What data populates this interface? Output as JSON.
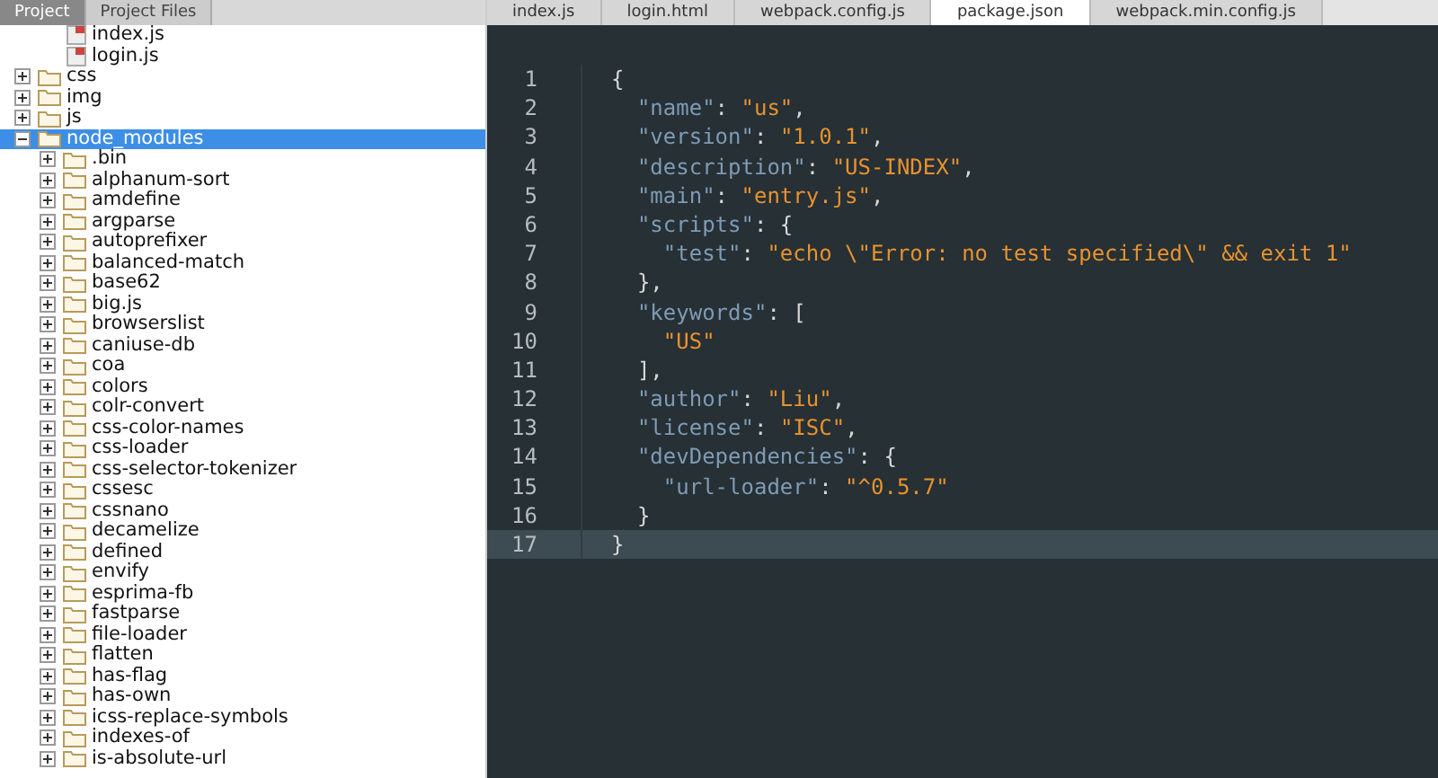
{
  "sidebar": {
    "tabs": [
      {
        "label": "Project",
        "selected": true
      },
      {
        "label": "Project Files",
        "selected": false
      }
    ],
    "tree": [
      {
        "label": "index.js",
        "kind": "file",
        "selected": false
      },
      {
        "label": "login.js",
        "kind": "file",
        "selected": false
      },
      {
        "label": "css",
        "kind": "folder",
        "expanded": false,
        "selected": false
      },
      {
        "label": "img",
        "kind": "folder",
        "expanded": false,
        "selected": false
      },
      {
        "label": "js",
        "kind": "folder",
        "expanded": false,
        "selected": false
      },
      {
        "label": "node_modules",
        "kind": "folder",
        "expanded": true,
        "selected": true,
        "children": [
          {
            "label": ".bin",
            "kind": "folder",
            "expanded": false,
            "selected": false
          },
          {
            "label": "alphanum-sort",
            "kind": "folder",
            "expanded": false,
            "selected": false
          },
          {
            "label": "amdefine",
            "kind": "folder",
            "expanded": false,
            "selected": false
          },
          {
            "label": "argparse",
            "kind": "folder",
            "expanded": false,
            "selected": false
          },
          {
            "label": "autoprefixer",
            "kind": "folder",
            "expanded": false,
            "selected": false
          },
          {
            "label": "balanced-match",
            "kind": "folder",
            "expanded": false,
            "selected": false
          },
          {
            "label": "base62",
            "kind": "folder",
            "expanded": false,
            "selected": false
          },
          {
            "label": "big.js",
            "kind": "folder",
            "expanded": false,
            "selected": false
          },
          {
            "label": "browserslist",
            "kind": "folder",
            "expanded": false,
            "selected": false
          },
          {
            "label": "caniuse-db",
            "kind": "folder",
            "expanded": false,
            "selected": false
          },
          {
            "label": "coa",
            "kind": "folder",
            "expanded": false,
            "selected": false
          },
          {
            "label": "colors",
            "kind": "folder",
            "expanded": false,
            "selected": false
          },
          {
            "label": "colr-convert",
            "kind": "folder",
            "expanded": false,
            "selected": false
          },
          {
            "label": "css-color-names",
            "kind": "folder",
            "expanded": false,
            "selected": false
          },
          {
            "label": "css-loader",
            "kind": "folder",
            "expanded": false,
            "selected": false
          },
          {
            "label": "css-selector-tokenizer",
            "kind": "folder",
            "expanded": false,
            "selected": false
          },
          {
            "label": "cssesc",
            "kind": "folder",
            "expanded": false,
            "selected": false
          },
          {
            "label": "cssnano",
            "kind": "folder",
            "expanded": false,
            "selected": false
          },
          {
            "label": "decamelize",
            "kind": "folder",
            "expanded": false,
            "selected": false
          },
          {
            "label": "defined",
            "kind": "folder",
            "expanded": false,
            "selected": false
          },
          {
            "label": "envify",
            "kind": "folder",
            "expanded": false,
            "selected": false
          },
          {
            "label": "esprima-fb",
            "kind": "folder",
            "expanded": false,
            "selected": false
          },
          {
            "label": "fastparse",
            "kind": "folder",
            "expanded": false,
            "selected": false
          },
          {
            "label": "file-loader",
            "kind": "folder",
            "expanded": false,
            "selected": false
          },
          {
            "label": "flatten",
            "kind": "folder",
            "expanded": false,
            "selected": false
          },
          {
            "label": "has-flag",
            "kind": "folder",
            "expanded": false,
            "selected": false
          },
          {
            "label": "has-own",
            "kind": "folder",
            "expanded": false,
            "selected": false
          },
          {
            "label": "icss-replace-symbols",
            "kind": "folder",
            "expanded": false,
            "selected": false
          },
          {
            "label": "indexes-of",
            "kind": "folder",
            "expanded": false,
            "selected": false
          },
          {
            "label": "is-absolute-url",
            "kind": "folder",
            "expanded": false,
            "selected": false
          }
        ]
      }
    ]
  },
  "editor": {
    "tabs": [
      {
        "label": "index.js",
        "selected": false
      },
      {
        "label": "login.html",
        "selected": false
      },
      {
        "label": "webpack.config.js",
        "selected": false
      },
      {
        "label": "package.json",
        "selected": true
      },
      {
        "label": "webpack.min.config.js",
        "selected": false
      }
    ],
    "lines": [
      {
        "number": "1",
        "current": false,
        "tokens": [
          {
            "kind": "punct",
            "text": "{"
          }
        ]
      },
      {
        "number": "2",
        "current": false,
        "tokens": [
          {
            "kind": "key",
            "text": "  \"name\""
          },
          {
            "kind": "punct",
            "text": ": "
          },
          {
            "kind": "string",
            "text": "\"us\""
          },
          {
            "kind": "punct",
            "text": ","
          }
        ]
      },
      {
        "number": "3",
        "current": false,
        "tokens": [
          {
            "kind": "key",
            "text": "  \"version\""
          },
          {
            "kind": "punct",
            "text": ": "
          },
          {
            "kind": "string",
            "text": "\"1.0.1\""
          },
          {
            "kind": "punct",
            "text": ","
          }
        ]
      },
      {
        "number": "4",
        "current": false,
        "tokens": [
          {
            "kind": "key",
            "text": "  \"description\""
          },
          {
            "kind": "punct",
            "text": ": "
          },
          {
            "kind": "string",
            "text": "\"US-INDEX\""
          },
          {
            "kind": "punct",
            "text": ","
          }
        ]
      },
      {
        "number": "5",
        "current": false,
        "tokens": [
          {
            "kind": "key",
            "text": "  \"main\""
          },
          {
            "kind": "punct",
            "text": ": "
          },
          {
            "kind": "string",
            "text": "\"entry.js\""
          },
          {
            "kind": "punct",
            "text": ","
          }
        ]
      },
      {
        "number": "6",
        "current": false,
        "tokens": [
          {
            "kind": "key",
            "text": "  \"scripts\""
          },
          {
            "kind": "punct",
            "text": ": {"
          }
        ]
      },
      {
        "number": "7",
        "current": false,
        "tokens": [
          {
            "kind": "key",
            "text": "    \"test\""
          },
          {
            "kind": "punct",
            "text": ": "
          },
          {
            "kind": "string",
            "text": "\"echo \\\"Error: no test specified\\\" && exit 1\""
          }
        ]
      },
      {
        "number": "8",
        "current": false,
        "tokens": [
          {
            "kind": "punct",
            "text": "  },"
          }
        ]
      },
      {
        "number": "9",
        "current": false,
        "tokens": [
          {
            "kind": "key",
            "text": "  \"keywords\""
          },
          {
            "kind": "punct",
            "text": ": ["
          }
        ]
      },
      {
        "number": "10",
        "current": false,
        "tokens": [
          {
            "kind": "string",
            "text": "    \"US\""
          }
        ]
      },
      {
        "number": "11",
        "current": false,
        "tokens": [
          {
            "kind": "punct",
            "text": "  ],"
          }
        ]
      },
      {
        "number": "12",
        "current": false,
        "tokens": [
          {
            "kind": "key",
            "text": "  \"author\""
          },
          {
            "kind": "punct",
            "text": ": "
          },
          {
            "kind": "string",
            "text": "\"Liu\""
          },
          {
            "kind": "punct",
            "text": ","
          }
        ]
      },
      {
        "number": "13",
        "current": false,
        "tokens": [
          {
            "kind": "key",
            "text": "  \"license\""
          },
          {
            "kind": "punct",
            "text": ": "
          },
          {
            "kind": "string",
            "text": "\"ISC\""
          },
          {
            "kind": "punct",
            "text": ","
          }
        ]
      },
      {
        "number": "14",
        "current": false,
        "tokens": [
          {
            "kind": "key",
            "text": "  \"devDependencies\""
          },
          {
            "kind": "punct",
            "text": ": {"
          }
        ]
      },
      {
        "number": "15",
        "current": false,
        "tokens": [
          {
            "kind": "key",
            "text": "    \"url-loader\""
          },
          {
            "kind": "punct",
            "text": ": "
          },
          {
            "kind": "string",
            "text": "\"^0.5.7\""
          }
        ]
      },
      {
        "number": "16",
        "current": false,
        "tokens": [
          {
            "kind": "punct",
            "text": "  }"
          }
        ]
      },
      {
        "number": "17",
        "current": true,
        "tokens": [
          {
            "kind": "punct",
            "text": "}"
          }
        ]
      }
    ]
  }
}
